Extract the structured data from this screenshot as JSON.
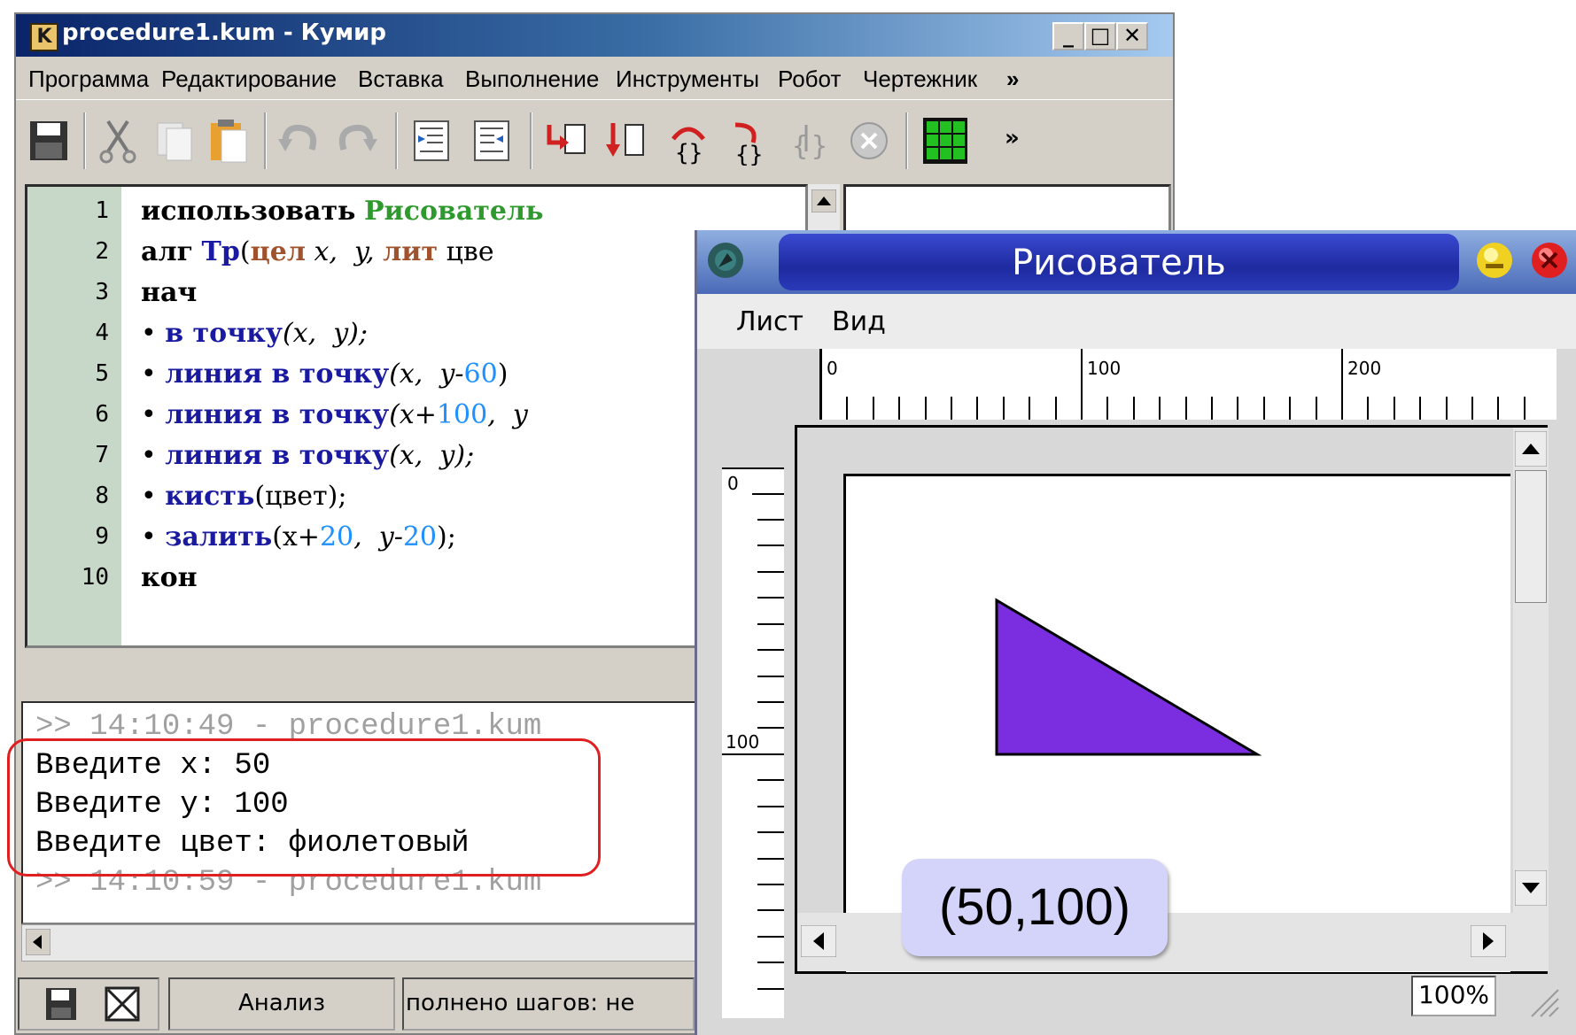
{
  "main_window": {
    "title": "procedure1.kum - Кумир",
    "app_icon_letter": "K",
    "menu": [
      "Программа",
      "Редактирование",
      "Вставка",
      "Выполнение",
      "Инструменты",
      "Робот",
      "Чертежник",
      "»"
    ],
    "toolbar_overflow": "»",
    "toolbar_icons": [
      "save-icon",
      "cut-icon",
      "copy-icon",
      "paste-icon",
      "undo-icon",
      "redo-icon",
      "indent-icon",
      "unindent-icon",
      "run-icon",
      "step-icon",
      "step-in-icon",
      "step-out-icon",
      "step-over-icon",
      "stop-icon",
      "grid-icon"
    ],
    "line_numbers": [
      "1",
      "2",
      "3",
      "4",
      "5",
      "6",
      "7",
      "8",
      "9",
      "10"
    ],
    "code": {
      "l1_kw": "использовать",
      "l1_mod": "Рисователь",
      "l2_kw": "алг",
      "l2_name": "Тр",
      "l2_open": "(",
      "l2_type1": "цел",
      "l2_args": " x,  y,",
      "l2_type2": "лит",
      "l2_rest": "цве",
      "l3": "нач",
      "bullet": "•",
      "l4_fn": "в точку",
      "l4_args": "(x,  y);",
      "l5_fn": "линия в точку",
      "l5_a": "(x,  y-",
      "l5_n": "60",
      "l5_b": ")",
      "l6_fn": "линия в точку",
      "l6_a": "(x+",
      "l6_n": "100",
      "l6_b": ",  y",
      "l7_fn": "линия в точку",
      "l7_args": "(x,  y);",
      "l8_fn": "кисть",
      "l8_args": "(цвет);",
      "l9_fn": "залить",
      "l9_a": "(x+",
      "l9_n1": "20",
      "l9_b": ",  y-",
      "l9_n2": "20",
      "l9_c": ");",
      "l10": "кон"
    },
    "console_lines": [
      ">> 14:10:49 - procedure1.kum",
      "Введите x: 50",
      "Введите y: 100",
      "Введите цвет: фиолетовый",
      ">> 14:10:59 - procedure1.kum"
    ],
    "status": {
      "analysis": "Анализ",
      "steps": "полнено шагов: не"
    }
  },
  "drawer_window": {
    "title": "Рисователь",
    "menu": [
      "Лист",
      "Вид"
    ],
    "hruler_labels": [
      "0",
      "100",
      "200"
    ],
    "vruler_labels": [
      "0",
      "100"
    ],
    "zoom": "100%",
    "triangle_color": "#7a2ee0"
  },
  "callout": "(50,100)"
}
